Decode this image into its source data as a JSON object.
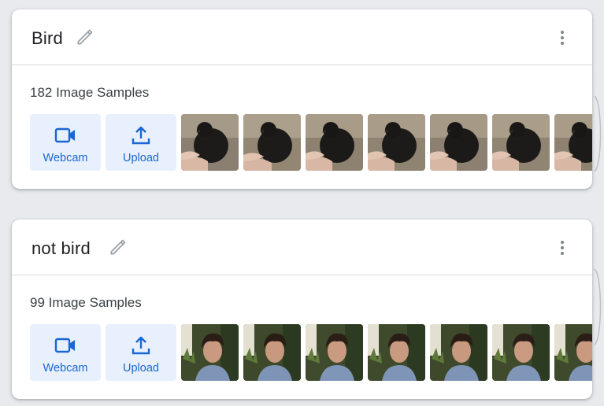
{
  "classes": [
    {
      "name": "Bird",
      "sample_count_label": "182 Image Samples",
      "webcam_label": "Webcam",
      "upload_label": "Upload"
    },
    {
      "name": "not bird",
      "sample_count_label": "99 Image Samples",
      "webcam_label": "Webcam",
      "upload_label": "Upload"
    }
  ],
  "colors": {
    "accent": "#1967d2",
    "button_bg": "#e8f0fe",
    "page_bg": "#e8eaed",
    "icon_gray": "#9aa0a6"
  },
  "icons": {
    "edit": "pencil-icon",
    "menu": "more-vert-icon",
    "webcam": "videocam-icon",
    "upload": "upload-icon"
  }
}
